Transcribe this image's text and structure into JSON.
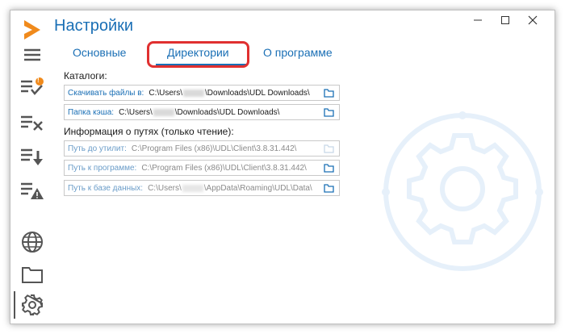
{
  "window": {
    "title": "Настройки",
    "controls": [
      "minimize",
      "maximize",
      "close"
    ]
  },
  "sidebar": {
    "items": [
      {
        "name": "menu-icon"
      },
      {
        "name": "tasks-done-icon",
        "badge": "!"
      },
      {
        "name": "tasks-cancel-icon"
      },
      {
        "name": "tasks-download-icon"
      },
      {
        "name": "tasks-warning-icon"
      },
      {
        "name": "globe-icon"
      },
      {
        "name": "folder-icon"
      },
      {
        "name": "gear-icon"
      }
    ]
  },
  "tabs": [
    {
      "label": "Основные"
    },
    {
      "label": "Директории",
      "active": true
    },
    {
      "label": "О программе"
    }
  ],
  "catalogs": {
    "heading": "Каталоги:",
    "download": {
      "label": "Скачивать файлы в:",
      "value": "C:\\Users\\",
      "value2": "\\Downloads\\UDL Downloads\\"
    },
    "cache": {
      "label": "Папка кэша:",
      "value": "C:\\Users\\",
      "value2": "\\Downloads\\UDL Downloads\\"
    }
  },
  "paths": {
    "heading": "Информация о путях (только чтение):",
    "utils": {
      "label": "Путь до утилит:",
      "value": "C:\\Program Files (x86)\\UDL\\Client\\3.8.31.442\\"
    },
    "program": {
      "label": "Путь к программе:",
      "value": "C:\\Program Files (x86)\\UDL\\Client\\3.8.31.442\\"
    },
    "db": {
      "label": "Путь к базе данных:",
      "value": "C:\\Users\\",
      "value2": "\\AppData\\Roaming\\UDL\\Data\\"
    }
  },
  "colors": {
    "accent": "#1a6fb5",
    "logo": "#f08a1c",
    "badge": "#f08a1c",
    "highlight": "#e03030"
  }
}
